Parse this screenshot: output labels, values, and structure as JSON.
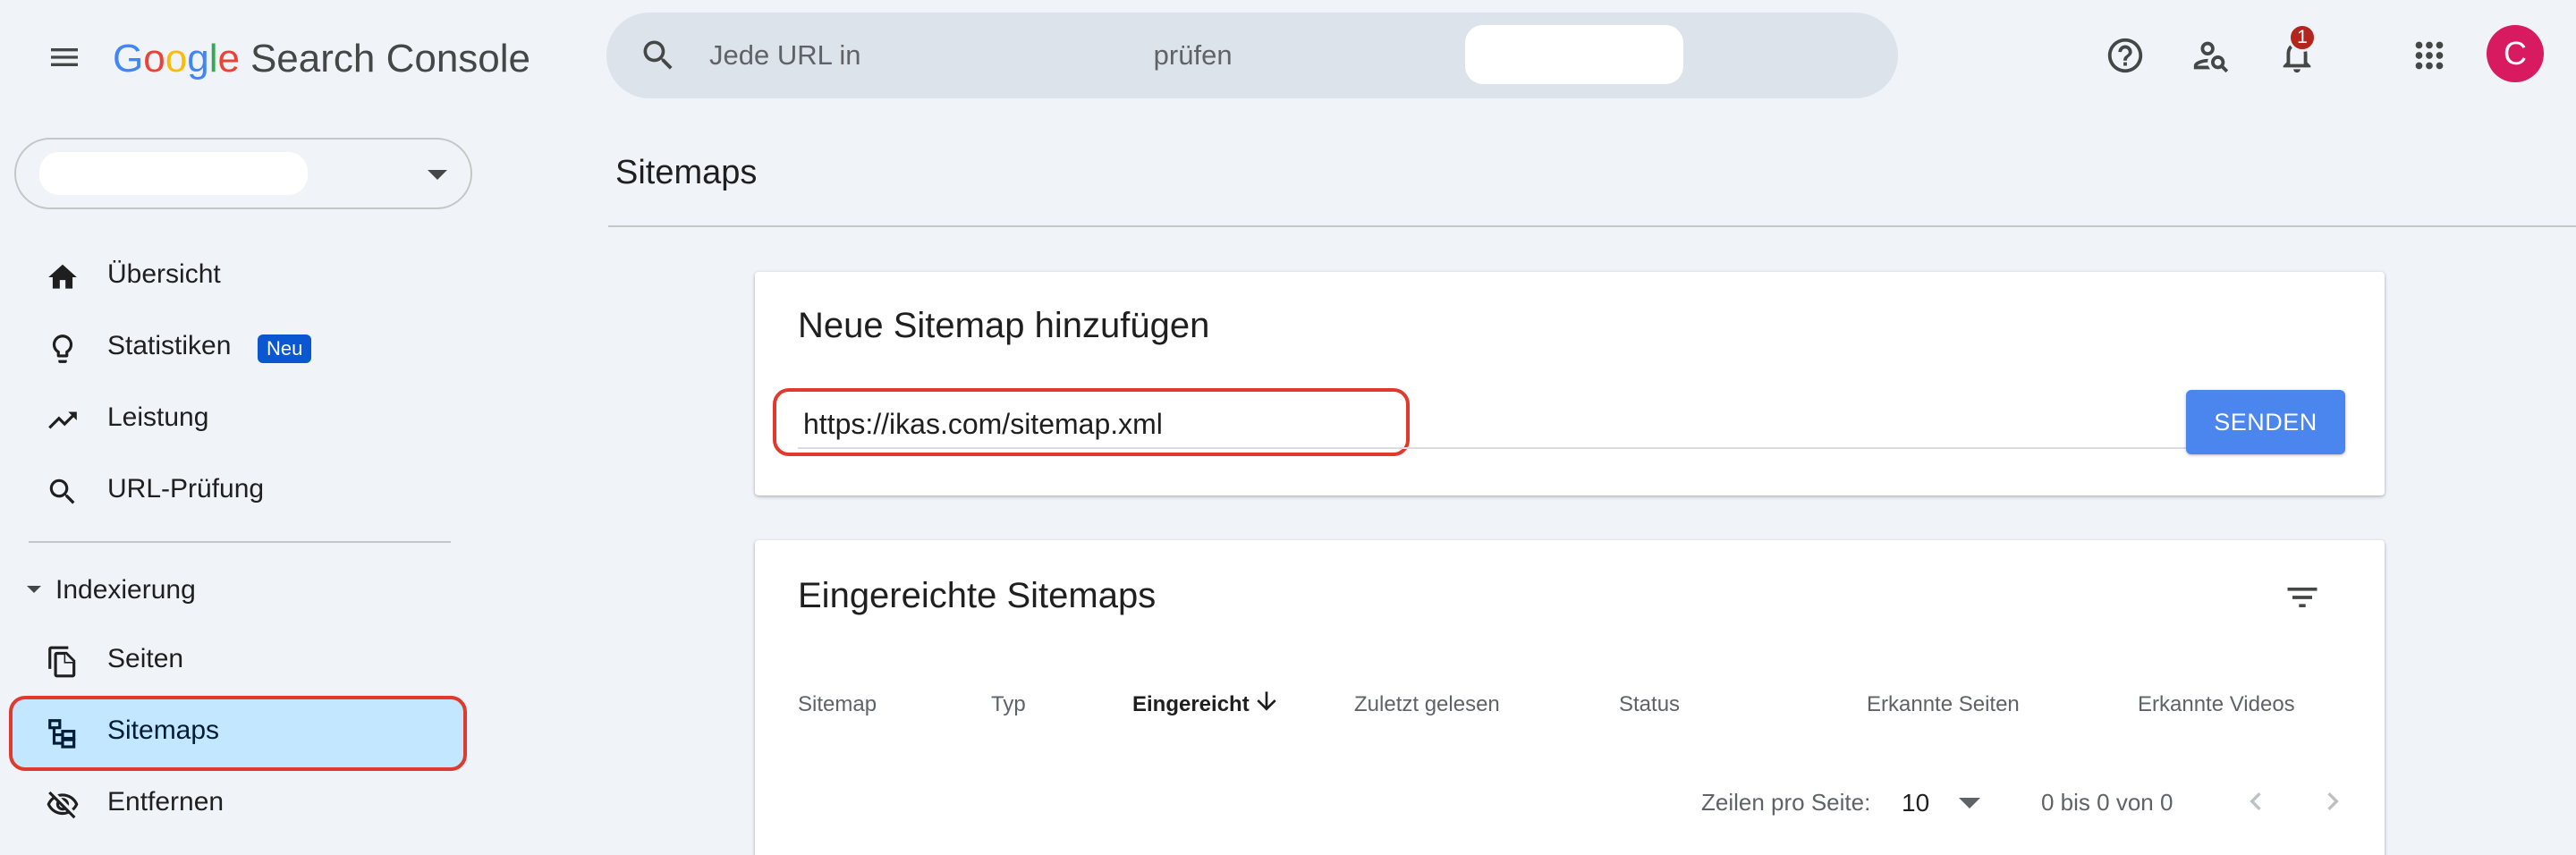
{
  "header": {
    "logo_parts": [
      "G",
      "o",
      "o",
      "g",
      "l",
      "e"
    ],
    "product": "Search Console",
    "search_placeholder": "Jede URL in            prüfen",
    "notification_count": "1",
    "avatar_letter": "C"
  },
  "sidebar": {
    "items": [
      {
        "label": "Übersicht"
      },
      {
        "label": "Statistiken",
        "badge": "Neu"
      },
      {
        "label": "Leistung"
      },
      {
        "label": "URL-Prüfung"
      }
    ],
    "section": {
      "label": "Indexierung"
    },
    "section_items": [
      {
        "label": "Seiten"
      },
      {
        "label": "Sitemaps"
      },
      {
        "label": "Entfernen"
      }
    ]
  },
  "main": {
    "page_title": "Sitemaps",
    "add_card": {
      "title": "Neue Sitemap hinzufügen",
      "input_value": "https://ikas.com/sitemap.xml",
      "submit_label": "SENDEN"
    },
    "list_card": {
      "title": "Eingereichte Sitemaps",
      "columns": [
        "Sitemap",
        "Typ",
        "Eingereicht",
        "Zuletzt gelesen",
        "Status",
        "Erkannte Seiten",
        "Erkannte Videos"
      ],
      "rows_per_page_label": "Zeilen pro Seite:",
      "rows_per_page_value": "10",
      "range_text": "0 bis 0 von 0"
    }
  },
  "colors": {
    "accent": "#0b57d0",
    "button": "#4a86ed",
    "active_nav": "#c2e7ff",
    "highlight_outline": "#e03a2f",
    "avatar": "#d81b60"
  }
}
